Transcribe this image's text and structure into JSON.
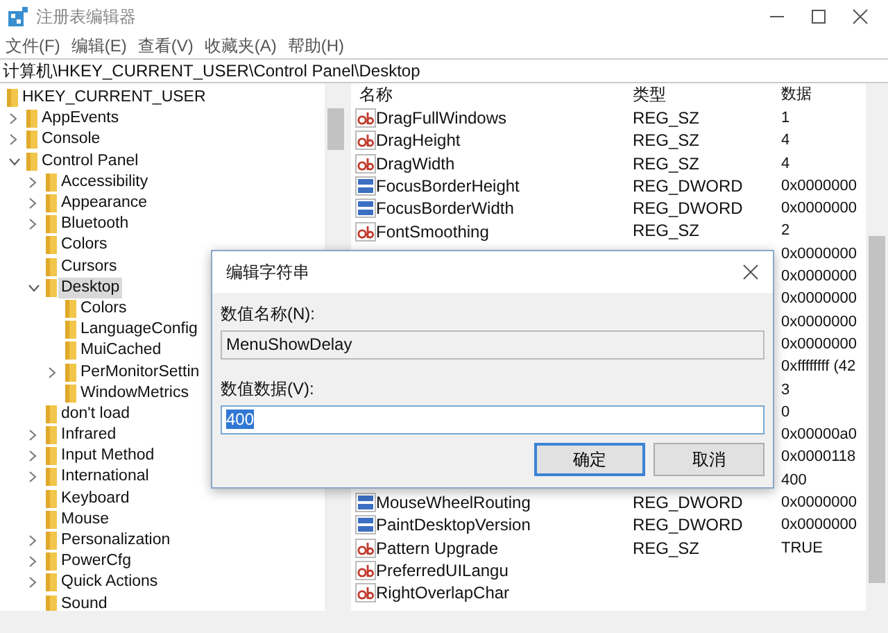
{
  "window": {
    "title": "注册表编辑器"
  },
  "menu": [
    "文件(F)",
    "编辑(E)",
    "查看(V)",
    "收藏夹(A)",
    "帮助(H)"
  ],
  "address": "计算机\\HKEY_CURRENT_USER\\Control Panel\\Desktop",
  "tree": [
    {
      "label": "HKEY_CURRENT_USER",
      "selected": false,
      "children": [
        {
          "label": "AppEvents",
          "expanded": false,
          "selected": false
        },
        {
          "label": "Console",
          "expanded": false,
          "selected": false
        },
        {
          "label": "Control Panel",
          "expanded": true,
          "selected": false,
          "children": [
            {
              "label": "Accessibility",
              "expanded": false,
              "selected": false
            },
            {
              "label": "Appearance",
              "expanded": false,
              "selected": false
            },
            {
              "label": "Bluetooth",
              "expanded": false,
              "selected": false
            },
            {
              "label": "Colors",
              "selected": false
            },
            {
              "label": "Cursors",
              "selected": false
            },
            {
              "label": "Desktop",
              "expanded": true,
              "selected": true,
              "children": [
                {
                  "label": "Colors",
                  "selected": false
                },
                {
                  "label": "LanguageConfig",
                  "selected": false
                },
                {
                  "label": "MuiCached",
                  "selected": false
                },
                {
                  "label": "PerMonitorSettin",
                  "expanded": false,
                  "selected": false
                },
                {
                  "label": "WindowMetrics",
                  "selected": false
                }
              ]
            },
            {
              "label": "don't load",
              "selected": false
            },
            {
              "label": "Infrared",
              "expanded": false,
              "selected": false
            },
            {
              "label": "Input Method",
              "expanded": false,
              "selected": false
            },
            {
              "label": "International",
              "expanded": false,
              "selected": false
            },
            {
              "label": "Keyboard",
              "selected": false
            },
            {
              "label": "Mouse",
              "selected": false
            },
            {
              "label": "Personalization",
              "expanded": false,
              "selected": false
            },
            {
              "label": "PowerCfg",
              "expanded": false,
              "selected": false
            },
            {
              "label": "Quick Actions",
              "expanded": false,
              "selected": false
            },
            {
              "label": "Sound",
              "selected": false
            }
          ]
        }
      ]
    }
  ],
  "list": {
    "columns": [
      "名称",
      "类型",
      "数据"
    ],
    "rows": [
      {
        "kind": "sz",
        "name": "DragFullWindows",
        "type": "REG_SZ",
        "data": "1"
      },
      {
        "kind": "sz",
        "name": "DragHeight",
        "type": "REG_SZ",
        "data": "4"
      },
      {
        "kind": "sz",
        "name": "DragWidth",
        "type": "REG_SZ",
        "data": "4"
      },
      {
        "kind": "dword",
        "name": "FocusBorderHeight",
        "type": "REG_DWORD",
        "data": "0x0000000"
      },
      {
        "kind": "dword",
        "name": "FocusBorderWidth",
        "type": "REG_DWORD",
        "data": "0x0000000"
      },
      {
        "kind": "sz",
        "name": "FontSmoothing",
        "type": "REG_SZ",
        "data": "2"
      },
      {
        "data": "0x0000000"
      },
      {
        "data": "0x0000000"
      },
      {
        "data": "0x0000000"
      },
      {
        "data": "0x0000000"
      },
      {
        "data": "0x0000000"
      },
      {
        "data": "0xffffffff (42"
      },
      {
        "data": "3"
      },
      {
        "data": "0"
      },
      {
        "data": "0x00000a0"
      },
      {
        "data": "0x0000118"
      },
      {
        "data": "400"
      },
      {
        "kind": "dword",
        "name": "MouseWheelRouting",
        "type": "REG_DWORD",
        "data": "0x0000000"
      },
      {
        "kind": "dword",
        "name": "PaintDesktopVersion",
        "type": "REG_DWORD",
        "data": "0x0000000"
      },
      {
        "kind": "sz",
        "name": "Pattern Upgrade",
        "type": "REG_SZ",
        "data": "TRUE"
      },
      {
        "kind": "sz",
        "name": "PreferredUILangu"
      },
      {
        "kind": "sz",
        "name": "RightOverlapChar"
      }
    ]
  },
  "dialog": {
    "title": "编辑字符串",
    "name_label": "数值名称(N):",
    "name_value": "MenuShowDelay",
    "data_label": "数值数据(V):",
    "data_value": "400",
    "buttons": [
      {
        "label": "确定",
        "default": true
      },
      {
        "label": "取消",
        "default": false
      }
    ]
  }
}
